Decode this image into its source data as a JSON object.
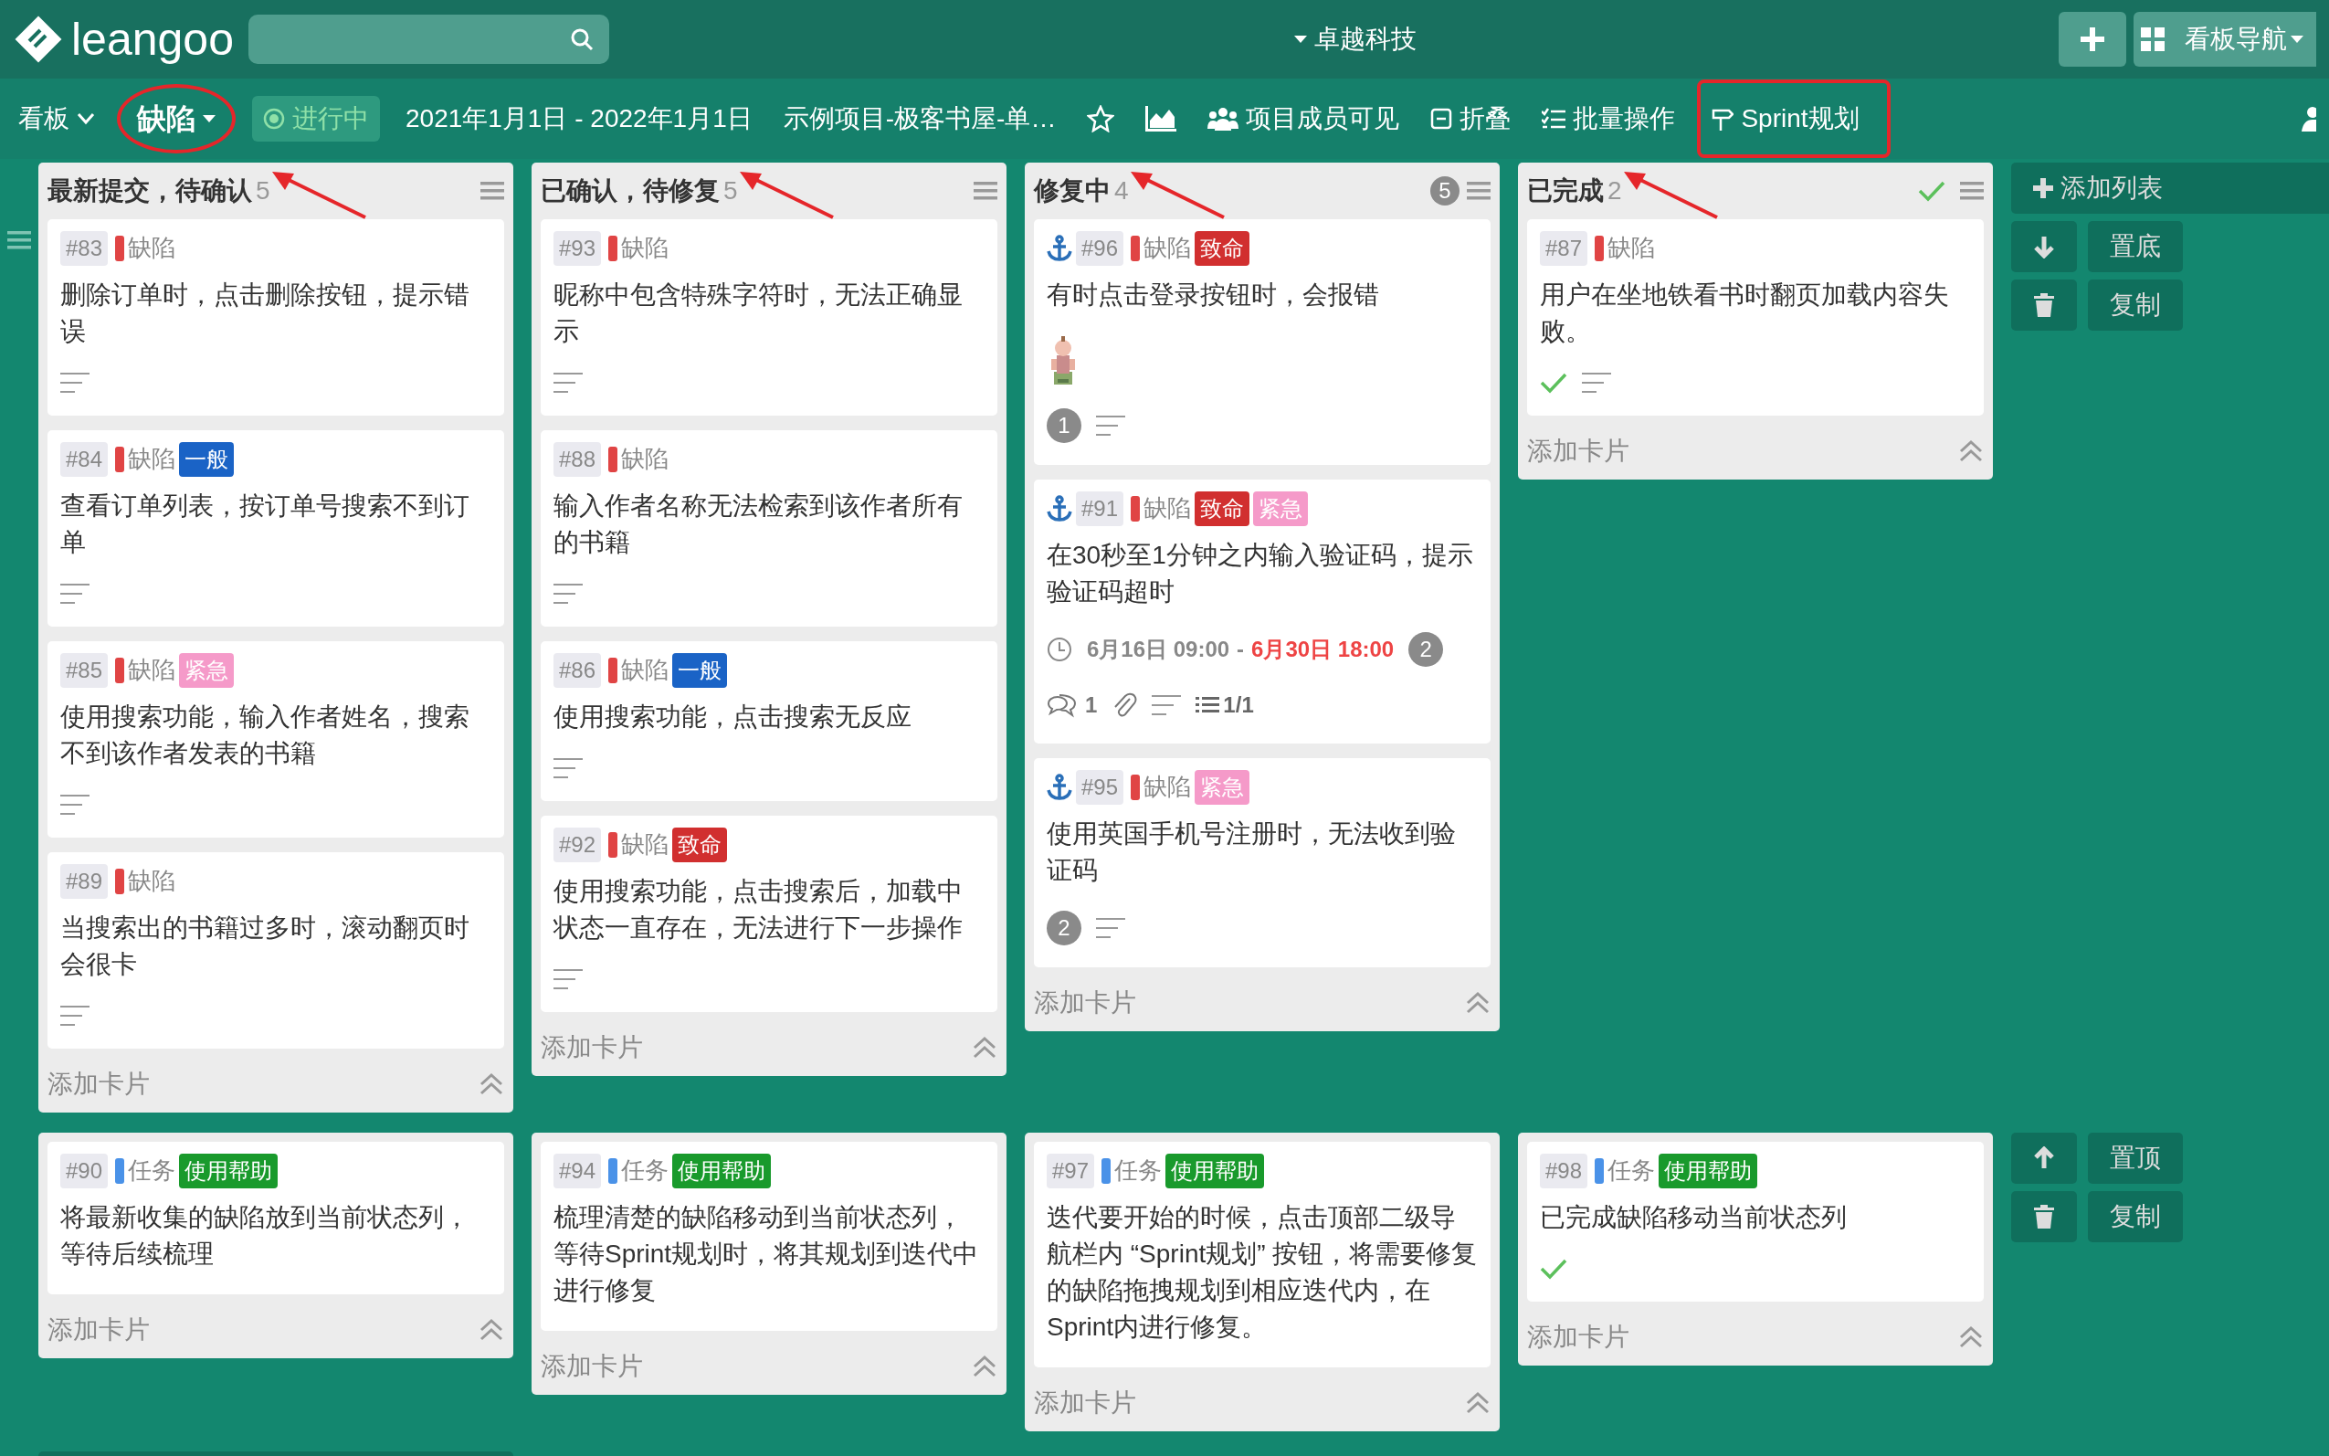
{
  "header": {
    "logo": "leangoo",
    "workspace": "卓越科技",
    "nav": "看板导航"
  },
  "toolbar": [
    {
      "kind": "menu",
      "label": "看板"
    },
    {
      "kind": "filter",
      "label": "缺陷",
      "circled": true
    },
    {
      "kind": "status",
      "label": "进行中"
    },
    {
      "kind": "text",
      "label": "2021年1月1日 - 2022年1月1日"
    },
    {
      "kind": "text",
      "label": "示例项目-极客书屋-单…"
    },
    {
      "kind": "star"
    },
    {
      "kind": "chart"
    },
    {
      "kind": "members",
      "label": "项目成员可见"
    },
    {
      "kind": "fold",
      "label": "折叠"
    },
    {
      "kind": "batch",
      "label": "批量操作"
    },
    {
      "kind": "sprint",
      "label": "Sprint规划",
      "boxed": true
    }
  ],
  "lanes": [
    {
      "lists": [
        {
          "title": "最新提交，待确认",
          "count": "5",
          "arrow": true,
          "add": "添加卡片",
          "cards": [
            {
              "number": "#83",
              "type": {
                "kind": "defect",
                "label": "缺陷"
              },
              "title": "删除订单时，点击删除按钮，提示错误",
              "footer": [
                [
                  {
                    "kind": "description"
                  }
                ]
              ]
            },
            {
              "number": "#84",
              "type": {
                "kind": "defect",
                "label": "缺陷"
              },
              "tags": [
                {
                  "label": "一般",
                  "color": "#1a63c6"
                }
              ],
              "title": "查看订单列表，按订单号搜索不到订单",
              "footer": [
                [
                  {
                    "kind": "description"
                  }
                ]
              ]
            },
            {
              "number": "#85",
              "type": {
                "kind": "defect",
                "label": "缺陷"
              },
              "tags": [
                {
                  "label": "紧急",
                  "color": "#f59ac9"
                }
              ],
              "title": "使用搜索功能，输入作者姓名，搜索不到该作者发表的书籍",
              "footer": [
                [
                  {
                    "kind": "description"
                  }
                ]
              ]
            },
            {
              "number": "#89",
              "type": {
                "kind": "defect",
                "label": "缺陷"
              },
              "title": "当搜索出的书籍过多时，滚动翻页时会很卡",
              "footer": [
                [
                  {
                    "kind": "description"
                  }
                ]
              ]
            }
          ]
        },
        {
          "title": "已确认，待修复",
          "count": "5",
          "arrow": true,
          "add": "添加卡片",
          "cards": [
            {
              "number": "#93",
              "type": {
                "kind": "defect",
                "label": "缺陷"
              },
              "title": "昵称中包含特殊字符时，无法正确显示",
              "footer": [
                [
                  {
                    "kind": "description"
                  }
                ]
              ]
            },
            {
              "number": "#88",
              "type": {
                "kind": "defect",
                "label": "缺陷"
              },
              "title": "输入作者名称无法检索到该作者所有的书籍",
              "footer": [
                [
                  {
                    "kind": "description"
                  }
                ]
              ]
            },
            {
              "number": "#86",
              "type": {
                "kind": "defect",
                "label": "缺陷"
              },
              "tags": [
                {
                  "label": "一般",
                  "color": "#1a63c6"
                }
              ],
              "title": "使用搜索功能，点击搜索无反应",
              "footer": [
                [
                  {
                    "kind": "description"
                  }
                ]
              ]
            },
            {
              "number": "#92",
              "type": {
                "kind": "defect",
                "label": "缺陷"
              },
              "tags": [
                {
                  "label": "致命",
                  "color": "#d12f2f"
                }
              ],
              "title": "使用搜索功能，点击搜索后，加载中状态一直存在，无法进行下一步操作",
              "footer": [
                [
                  {
                    "kind": "description"
                  }
                ]
              ]
            }
          ]
        },
        {
          "title": "修复中",
          "count": "4",
          "arrow": true,
          "wip": "5",
          "add": "添加卡片",
          "cards": [
            {
              "anchor": true,
              "number": "#96",
              "type": {
                "kind": "defect",
                "label": "缺陷"
              },
              "tags": [
                {
                  "label": "致命",
                  "color": "#d12f2f"
                }
              ],
              "title": "有时点击登录按钮时，会报错",
              "footer": [
                [
                  {
                    "kind": "picture"
                  }
                ],
                [
                  {
                    "kind": "badge",
                    "text": "1"
                  },
                  {
                    "kind": "description"
                  }
                ]
              ]
            },
            {
              "anchor": true,
              "number": "#91",
              "type": {
                "kind": "defect",
                "label": "缺陷"
              },
              "tags": [
                {
                  "label": "致命",
                  "color": "#d12f2f"
                },
                {
                  "label": "紧急",
                  "color": "#f59ac9"
                }
              ],
              "title": "在30秒至1分钟之内输入验证码，提示验证码超时",
              "footer": [
                [
                  {
                    "kind": "clock"
                  },
                  {
                    "kind": "date",
                    "text": "6月16日 09:00",
                    "overdue": false
                  },
                  {
                    "kind": "text",
                    "text": "-"
                  },
                  {
                    "kind": "date",
                    "text": "6月30日 18:00",
                    "overdue": true
                  },
                  {
                    "kind": "badge",
                    "text": "2"
                  }
                ],
                [
                  {
                    "kind": "comments",
                    "text": "1"
                  },
                  {
                    "kind": "attachment"
                  },
                  {
                    "kind": "description"
                  },
                  {
                    "kind": "checklist",
                    "text": "1/1"
                  }
                ]
              ]
            },
            {
              "anchor": true,
              "number": "#95",
              "type": {
                "kind": "defect",
                "label": "缺陷"
              },
              "tags": [
                {
                  "label": "紧急",
                  "color": "#f59ac9"
                }
              ],
              "title": "使用英国手机号注册时，无法收到验证码",
              "footer": [
                [
                  {
                    "kind": "badge",
                    "text": "2"
                  },
                  {
                    "kind": "description"
                  }
                ]
              ]
            }
          ]
        },
        {
          "title": "已完成",
          "count": "2",
          "arrow": true,
          "done": true,
          "add": "添加卡片",
          "cards": [
            {
              "number": "#87",
              "type": {
                "kind": "defect",
                "label": "缺陷"
              },
              "title": "用户在坐地铁看书时翻页加载内容失败。",
              "footer": [
                [
                  {
                    "kind": "done"
                  },
                  {
                    "kind": "description"
                  }
                ]
              ]
            }
          ]
        }
      ],
      "actions": [
        {
          "kind": "add-list",
          "label": "添加列表"
        },
        {
          "kind": "bottom",
          "label": "置底"
        },
        {
          "kind": "copy",
          "label": "复制"
        }
      ]
    },
    {
      "lists": [
        {
          "add": "添加卡片",
          "cards": [
            {
              "number": "#90",
              "type": {
                "kind": "task",
                "label": "任务"
              },
              "tags": [
                {
                  "label": "使用帮助",
                  "color": "#199a2c"
                }
              ],
              "title": "将最新收集的缺陷放到当前状态列，等待后续梳理"
            }
          ]
        },
        {
          "add": "添加卡片",
          "cards": [
            {
              "number": "#94",
              "type": {
                "kind": "task",
                "label": "任务"
              },
              "tags": [
                {
                  "label": "使用帮助",
                  "color": "#199a2c"
                }
              ],
              "title": "梳理清楚的缺陷移动到当前状态列，等待Sprint规划时，将其规划到迭代中进行修复"
            }
          ]
        },
        {
          "add": "添加卡片",
          "cards": [
            {
              "number": "#97",
              "type": {
                "kind": "task",
                "label": "任务"
              },
              "tags": [
                {
                  "label": "使用帮助",
                  "color": "#199a2c"
                }
              ],
              "title": "迭代要开始的时候，点击顶部二级导航栏内 “Sprint规划” 按钮，将需要修复的缺陷拖拽规划到相应迭代内，在Sprint内进行修复。"
            }
          ]
        },
        {
          "add": "添加卡片",
          "cards": [
            {
              "number": "#98",
              "type": {
                "kind": "task",
                "label": "任务"
              },
              "tags": [
                {
                  "label": "使用帮助",
                  "color": "#199a2c"
                }
              ],
              "title": "已完成缺陷移动当前状态列",
              "footer": [
                [
                  {
                    "kind": "done"
                  }
                ]
              ]
            }
          ]
        }
      ],
      "actions": [
        {
          "kind": "top",
          "label": "置顶"
        },
        {
          "kind": "copy",
          "label": "复制"
        }
      ]
    }
  ]
}
